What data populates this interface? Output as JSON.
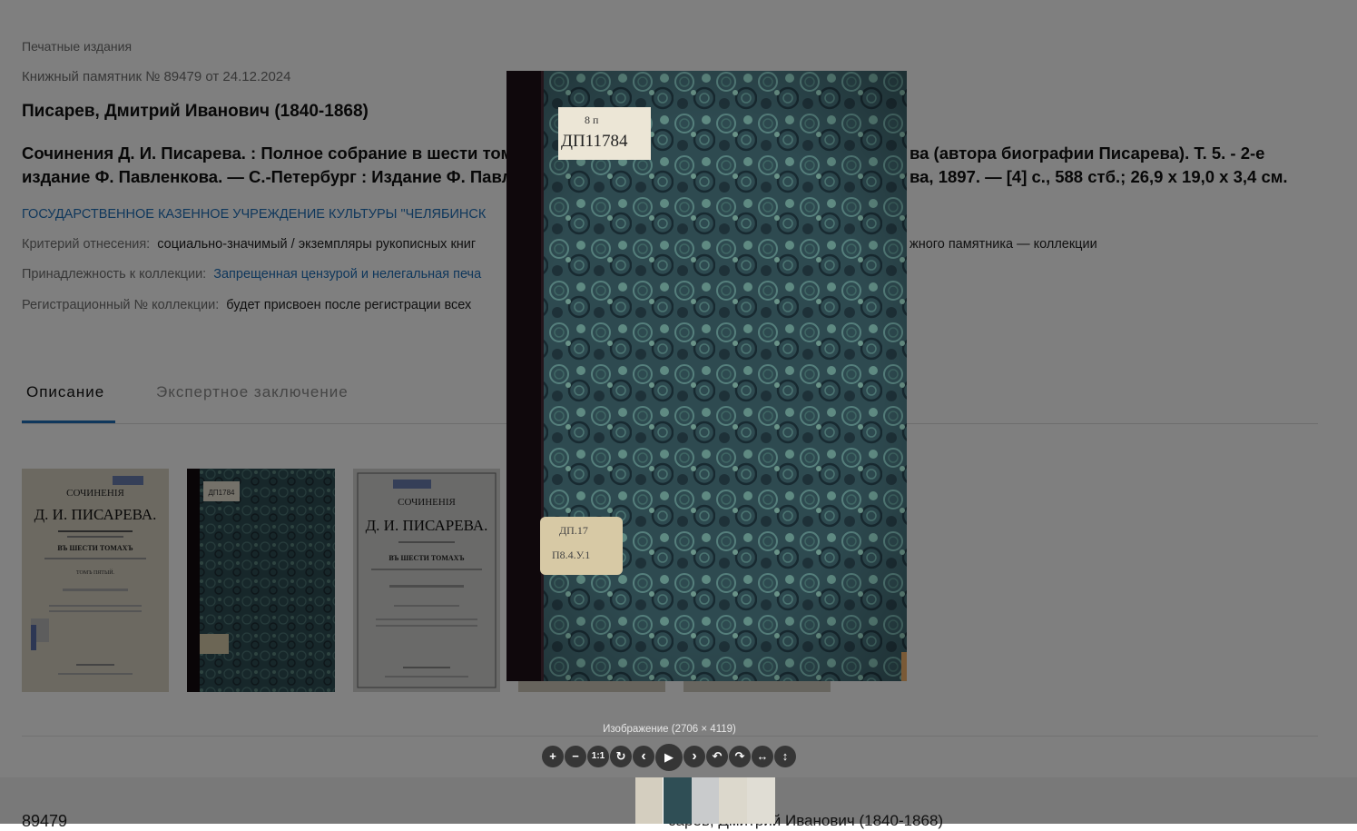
{
  "breadcrumb": "Печатные издания",
  "record": "Книжный памятник № 89479 от 24.12.2024",
  "author": "Писарев, Дмитрий Иванович (1840-1868)",
  "title": "Сочинения Д. И. Писарева. : Полное собрание в шести томах.                                                                                 ва (автора биографии Писарева). Т. 5. - 2-е издание Ф. Павленкова. — С.-Петербург : Издание Ф. Павле                                                                   ва, 1897. — [4] с., 588 стб.; 26,9 x 19,0 x 3,4 см.",
  "title_left": "Сочинения Д. И. Писарева. : Полное собрание в шести томах",
  "title_right1": "ва (автора биографии Писарева). Т. 5. - 2-е",
  "title_left2": "издание Ф. Павленкова. — С.-Петербург : Издание Ф. Павле",
  "title_right2": "ва, 1897. — [4] с., 588 стб.; 26,9 x 19,0 x 3,4 см.",
  "organization": "ГОСУДАРСТВЕННОЕ КАЗЕННОЕ УЧРЕЖДЕНИЕ КУЛЬТУРЫ \"ЧЕЛЯБИНСК",
  "criteria": {
    "label": "Критерий отнесения:",
    "value_left": "социально-значимый / экземпляры рукописных книг",
    "value_right": "жного памятника — коллекции"
  },
  "collection": {
    "label": "Принадлежность к коллекции:",
    "value": "Запрещенная цензурой и нелегальная печа"
  },
  "collection_reg": {
    "label": "Регистрационный № коллекции:",
    "value": "будет присвоен после регистрации всех"
  },
  "tabs": [
    {
      "label": "Описание",
      "active": true
    },
    {
      "label": "Экспертное заключение",
      "active": false
    }
  ],
  "thumbnails": [
    {
      "caption_1": "СОЧИНЕНІЯ",
      "caption_2": "Д. И. ПИСАРЕВА.",
      "caption_3": "ВЪ ШЕСТИ ТОМАХЪ",
      "caption_4": "ТОМЪ ПЯТЫЙ."
    },
    {
      "label": "ДП1784"
    },
    {
      "caption_1": "СОЧИНЕНІЯ",
      "caption_2": "Д. И. ПИСАРЕВА.",
      "caption_3": "ВЪ ШЕСТИ ТОМАХЪ"
    }
  ],
  "footer": {
    "record_id": "89479",
    "author": "сарев, Дмитрий Иванович (1840-1868)"
  },
  "viewer": {
    "caption": "Изображение (2706 × 4119)",
    "label_top_1": "8 п",
    "label_top_2": "ДП11784",
    "label_bottom_1": "ДП.17",
    "label_bottom_2": "П8.4.У.1",
    "toolbar": {
      "zoom_in": "+",
      "zoom_out": "−",
      "one_to_one": "1:1",
      "reset": "↻",
      "prev": "‹",
      "play": "▶",
      "next": "›",
      "rotate_left": "↶",
      "rotate_right": "↷",
      "flip_h": "↔",
      "flip_v": "↕"
    }
  },
  "colors": {
    "link": "#1f6fb8",
    "accent_underline": "#1f6fb8",
    "overlay": "rgba(0,0,0,0.5)",
    "cover_marble": "#2f4e55"
  }
}
